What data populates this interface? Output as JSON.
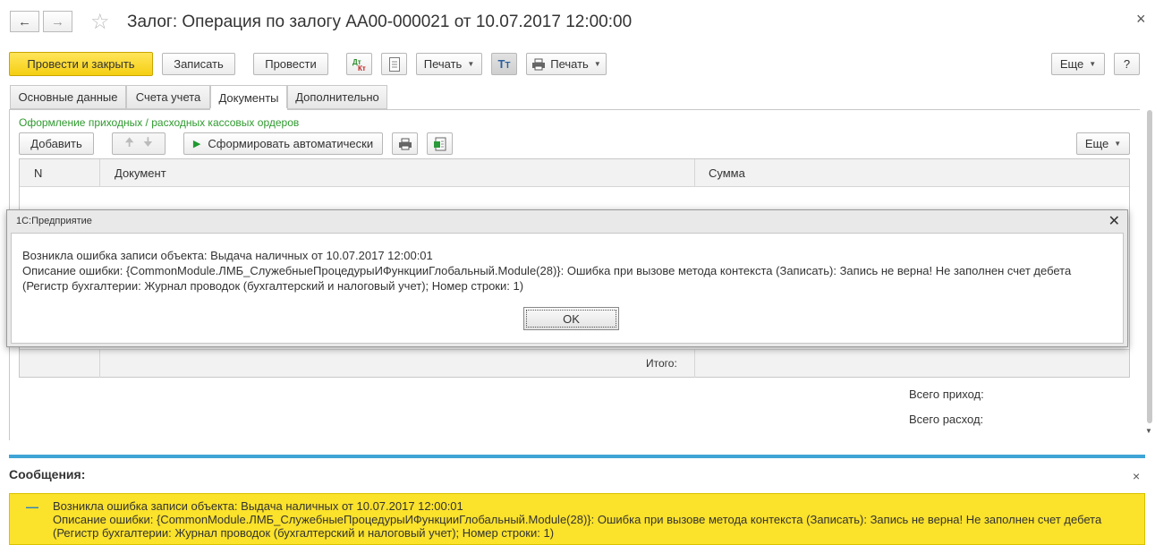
{
  "window": {
    "title": "Залог: Операция по залогу АА00-000021 от 10.07.2017 12:00:00",
    "close_glyph": "×"
  },
  "toolbar": {
    "post_and_close": "Провести и закрыть",
    "write": "Записать",
    "post": "Провести",
    "dtkt_icon": "dt-kt-icon",
    "print1": "Печать",
    "print2": "Печать",
    "more": "Еще",
    "help": "?"
  },
  "tabs": [
    {
      "label": "Основные данные",
      "active": false
    },
    {
      "label": "Счета учета",
      "active": false
    },
    {
      "label": "Документы",
      "active": true
    },
    {
      "label": "Дополнительно",
      "active": false
    }
  ],
  "section": {
    "title": "Оформление приходных / расходных кассовых ордеров",
    "add": "Добавить",
    "generate": "Сформировать автоматически",
    "more": "Еще"
  },
  "table": {
    "columns": [
      "N",
      "Документ",
      "Сумма"
    ],
    "footer_label": "Итого:"
  },
  "totals": {
    "income_label": "Всего приход:",
    "expense_label": "Всего расход:"
  },
  "dialog": {
    "title": "1С:Предприятие",
    "close_glyph": "✕",
    "line1": "Возникла ошибка записи объекта: Выдача наличных  от 10.07.2017 12:00:01",
    "line2": "Описание ошибки: {CommonModule.ЛМБ_СлужебныеПроцедурыИФункцииГлобальный.Module(28)}: Ошибка при вызове метода контекста (Записать): Запись не верна! Не заполнен счет дебета (Регистр бухгалтерии: Журнал проводок (бухгалтерский и налоговый учет); Номер строки: 1)",
    "ok": "OK"
  },
  "messages": {
    "title": "Сообщения:",
    "close_glyph": "×",
    "dash": "—",
    "line1": "Возникла ошибка записи объекта: Выдача наличных  от 10.07.2017 12:00:01",
    "line2": "Описание ошибки: {CommonModule.ЛМБ_СлужебныеПроцедурыИФункцииГлобальный.Module(28)}: Ошибка при вызове метода контекста (Записать): Запись не верна! Не заполнен счет дебета",
    "line3": "(Регистр бухгалтерии: Журнал проводок (бухгалтерский и налоговый учет); Номер строки: 1)"
  },
  "colors": {
    "primary_button": "#f5cf12",
    "section_title": "#2f9a2f",
    "messages_accent": "#3fa4d6",
    "message_background": "#fbe22b"
  }
}
